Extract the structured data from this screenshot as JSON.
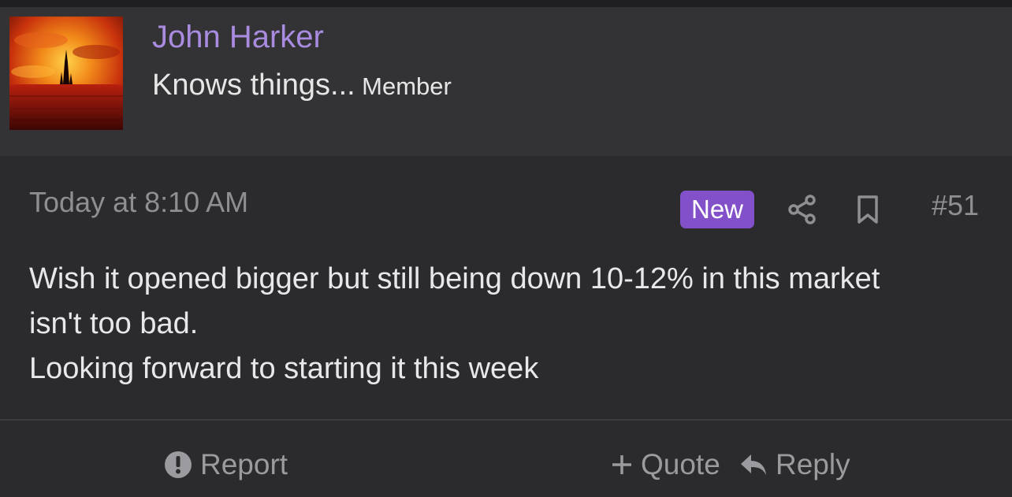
{
  "user": {
    "name": "John Harker",
    "title": "Knows things...",
    "role": "Member"
  },
  "post": {
    "timestamp": "Today at 8:10 AM",
    "badge": "New",
    "number": "#51",
    "body_lines": [
      "Wish it opened bigger but still being down 10-12% in this market",
      "isn't too bad.",
      "Looking forward to starting it this week"
    ]
  },
  "actions": {
    "report": "Report",
    "quote": "Quote",
    "reply": "Reply"
  },
  "icons": {
    "share": "share-icon",
    "bookmark": "bookmark-icon",
    "report": "alert-circle-icon",
    "quote": "plus-icon",
    "reply": "reply-icon"
  },
  "colors": {
    "accent": "#8250c9",
    "username": "#a98be0",
    "background": "#2b2b2e",
    "header": "#333336"
  }
}
